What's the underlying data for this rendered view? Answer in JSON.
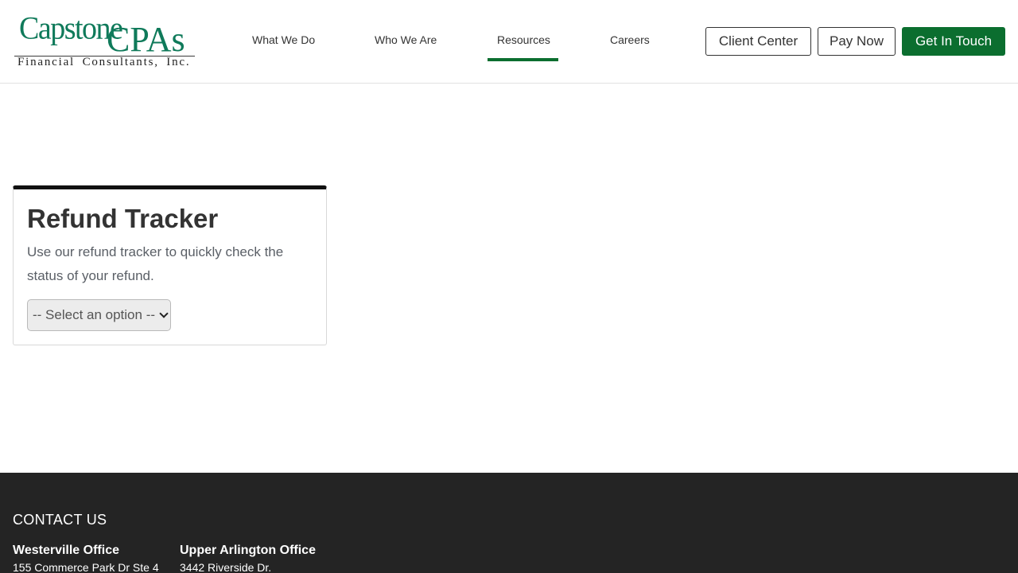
{
  "header": {
    "logo": {
      "line1": "Capstone",
      "line2": "CPAs",
      "tagline": "Financial Consultants, Inc."
    },
    "nav": [
      {
        "label": "What We Do"
      },
      {
        "label": "Who We Are"
      },
      {
        "label": "Resources",
        "active": true
      },
      {
        "label": "Careers"
      }
    ],
    "buttons": {
      "client_center": "Client Center",
      "pay_now": "Pay Now",
      "get_in_touch": "Get In Touch"
    }
  },
  "card": {
    "title": "Refund Tracker",
    "description": "Use our refund tracker to quickly check the status of your refund.",
    "select_value": "-- Select an option --"
  },
  "footer": {
    "heading": "CONTACT US",
    "offices": [
      {
        "name": "Westerville Office",
        "address": "155 Commerce Park Dr Ste 4"
      },
      {
        "name": "Upper Arlington Office",
        "address": "3442 Riverside Dr."
      }
    ]
  },
  "colors": {
    "brand_green": "#0b6e2f",
    "logo_green": "#0f7a5a",
    "footer_bg": "#242424"
  }
}
